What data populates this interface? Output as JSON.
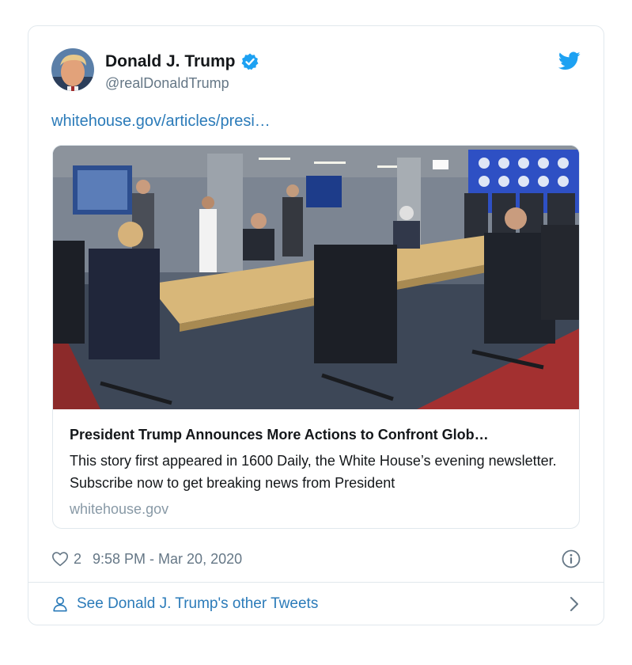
{
  "author": {
    "display_name": "Donald J. Trump",
    "handle": "@realDonaldTrump",
    "avatar_icon": "profile-avatar",
    "verified_icon": "verified-badge-icon"
  },
  "brand": {
    "icon": "twitter-bird-icon",
    "accent": "#1da1f2",
    "link_color": "#2b7bb9"
  },
  "tweet": {
    "link_text": "whitehouse.gov/articles/presi…"
  },
  "link_card": {
    "image_icon": "meeting-room-photo",
    "title": "President Trump Announces More Actions to Confront Glob…",
    "description": "This story first appeared in 1600 Daily, the White House’s evening newsletter. Subscribe now to get breaking news from President",
    "domain": "whitehouse.gov"
  },
  "meta": {
    "like_count": "2",
    "timestamp": "9:58 PM - Mar 20, 2020",
    "heart_icon": "heart-icon",
    "info_icon": "info-icon"
  },
  "footer": {
    "label": "See Donald J. Trump's other Tweets",
    "person_icon": "person-icon",
    "chevron_icon": "chevron-right-icon"
  }
}
